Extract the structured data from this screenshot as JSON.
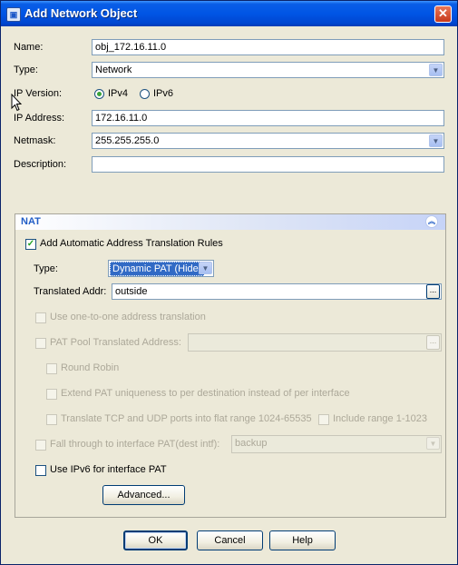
{
  "window": {
    "title": "Add Network Object",
    "close_glyph": "✕",
    "icon": "app-icon"
  },
  "form": {
    "name_label": "Name:",
    "name_value": "obj_172.16.11.0",
    "type_label": "Type:",
    "type_value": "Network",
    "ipversion_label": "IP Version:",
    "ipv4_label": "IPv4",
    "ipv6_label": "IPv6",
    "selected_ip_version": "IPv4",
    "ipaddress_label": "IP Address:",
    "ipaddress_value": "172.16.11.0",
    "netmask_label": "Netmask:",
    "netmask_value": "255.255.255.0",
    "description_label": "Description:",
    "description_value": ""
  },
  "nat": {
    "title": "NAT",
    "auto_rules_label": "Add Automatic Address Translation Rules",
    "auto_rules_checked": true,
    "type_label": "Type:",
    "type_value": "Dynamic PAT (Hide)",
    "translated_label": "Translated Addr:",
    "translated_value": "outside",
    "browse_glyph": "...",
    "one_to_one_label": "Use one-to-one address translation",
    "pat_pool_label": "PAT Pool Translated Address:",
    "round_robin_label": "Round Robin",
    "extend_pat_label": "Extend PAT uniqueness to per destination instead of per interface",
    "translate_tcp_label": "Translate TCP and UDP ports into flat range 1024-65535",
    "include_range_label": "Include range 1-1023",
    "fall_through_label": "Fall through to interface PAT(dest intf):",
    "fall_through_value": "backup",
    "ipv6_pat_label": "Use IPv6 for interface PAT",
    "advanced_label": "Advanced..."
  },
  "buttons": {
    "ok": "OK",
    "cancel": "Cancel",
    "help": "Help"
  },
  "colors": {
    "title_bar": "#0055e5",
    "nat_header_text": "#215dc6",
    "close_button": "#c7391b"
  }
}
